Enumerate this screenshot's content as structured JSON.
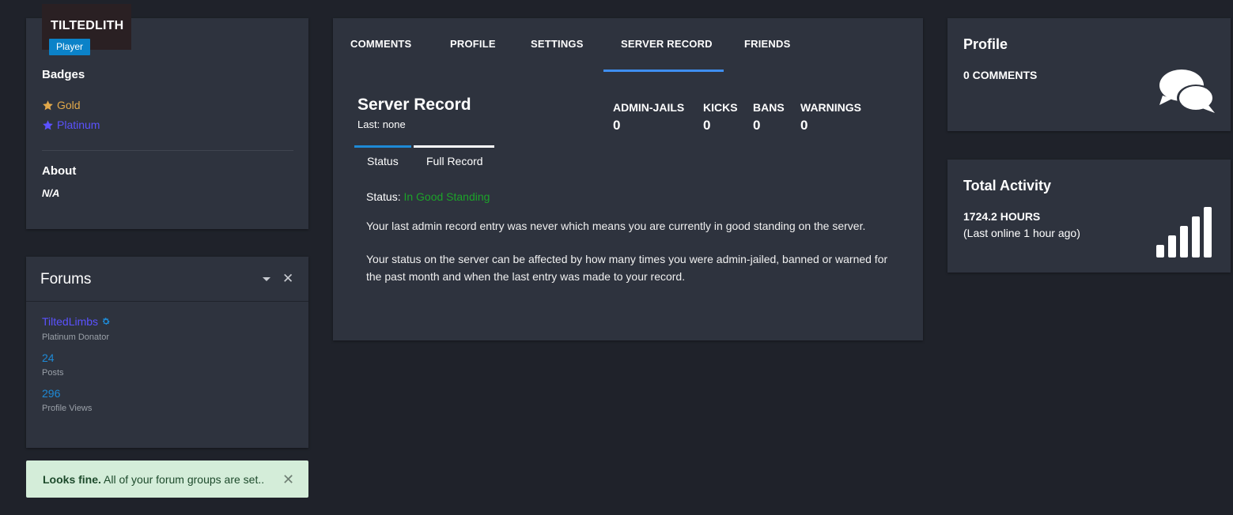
{
  "profile_card": {
    "username": "TILTEDLITH",
    "role": "Player",
    "badges_title": "Badges",
    "badges": [
      {
        "label": "Gold",
        "color": "#e1a84a",
        "icon": "star-icon"
      },
      {
        "label": "Platinum",
        "color": "#5b52ff",
        "icon": "star-icon"
      }
    ],
    "about_title": "About",
    "about_value": "N/A"
  },
  "forums_card": {
    "title": "Forums",
    "user_link": "TiltedLimbs",
    "user_rank": "Platinum Donator",
    "posts_count": "24",
    "posts_label": "Posts",
    "views_count": "296",
    "views_label": "Profile Views"
  },
  "alert": {
    "strong": "Looks fine.",
    "message": " All of your forum groups are set.."
  },
  "main_tabs": [
    "COMMENTS",
    "PROFILE",
    "SETTINGS",
    "SERVER RECORD",
    "FRIENDS"
  ],
  "active_tab": "SERVER RECORD",
  "server_record": {
    "title": "Server Record",
    "last": "Last: none",
    "stats": [
      {
        "label": "ADMIN-JAILS",
        "value": "0"
      },
      {
        "label": "KICKS",
        "value": "0"
      },
      {
        "label": "BANS",
        "value": "0"
      },
      {
        "label": "WARNINGS",
        "value": "0"
      }
    ],
    "sub_tabs": [
      "Status",
      "Full Record"
    ],
    "status_label": "Status: ",
    "status_value": "In Good Standing",
    "paragraph1": "Your last admin record entry was never which means you are currently in good standing on the server.",
    "paragraph2": "Your status on the server can be affected by how many times you were admin-jailed, banned or warned for the past month and when the last entry was made to your record."
  },
  "right_profile": {
    "title": "Profile",
    "value": "0 COMMENTS"
  },
  "right_activity": {
    "title": "Total Activity",
    "value": "1724.2 HOURS",
    "sub": "(Last online 1 hour ago)"
  },
  "colors": {
    "background": "#1f222a",
    "panel": "#2e333e",
    "accent_blue": "#3f8ef0",
    "good_green": "#1ca329"
  }
}
